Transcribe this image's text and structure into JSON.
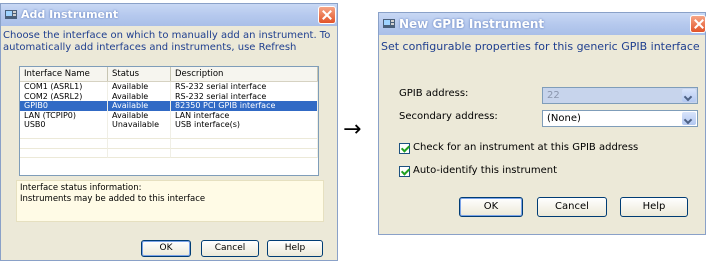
{
  "left_dialog": {
    "title": "Add Instrument",
    "instructions": [
      "Choose the interface on which to manually add an instrument.  To",
      "automatically add interfaces and instruments, use Refresh"
    ],
    "columns": [
      "Interface Name",
      "Status",
      "Description"
    ],
    "rows": [
      [
        "COM1 (ASRL1)",
        "Available",
        "RS-232 serial interface"
      ],
      [
        "COM2 (ASRL2)",
        "Available",
        "RS-232 serial interface"
      ],
      [
        "GPIB0",
        "Available",
        "82350 PCI GPIB interface"
      ],
      [
        "LAN (TCPIP0)",
        "Available",
        "LAN interface"
      ],
      [
        "USB0",
        "Unavailable",
        "USB interface(s)"
      ]
    ],
    "selected_row": 2,
    "status_heading": "Interface status information:",
    "status_text": "Instruments may be added to this interface",
    "ok_label": "OK",
    "cancel_label": "Cancel",
    "help_label": "Help"
  },
  "arrow": "→",
  "right_dialog": {
    "title": "New GPIB Instrument",
    "subtitle": "Set configurable properties for this generic GPIB interface",
    "gpib_address_label": "GPIB address:",
    "gpib_address_value": "22",
    "secondary_address_label": "Secondary address:",
    "secondary_address_value": "(None)",
    "check_label": "Check for an instrument at this GPIB address",
    "check_checked": true,
    "auto_identify_label": "Auto-identify this instrument",
    "auto_identify_checked": true,
    "ok_label": "OK",
    "cancel_label": "Cancel",
    "help_label": "Help"
  }
}
